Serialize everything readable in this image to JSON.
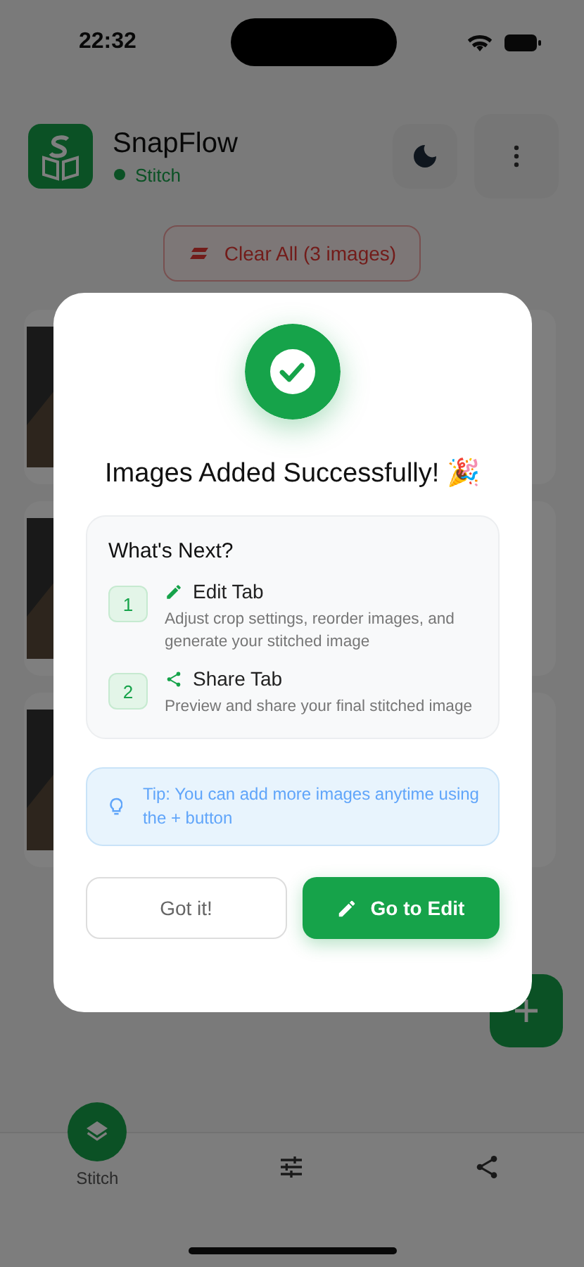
{
  "status_bar": {
    "time": "22:32"
  },
  "header": {
    "title": "SnapFlow",
    "subtitle": "Stitch"
  },
  "clear_button": {
    "label": "Clear All (3 images)"
  },
  "dialog": {
    "title": "Images Added Successfully! 🎉",
    "section_title": "What's Next?",
    "steps": [
      {
        "number": "1",
        "kind": "edit",
        "title": "Edit Tab",
        "description": "Adjust crop settings, reorder images, and generate your stitched image"
      },
      {
        "number": "2",
        "kind": "share",
        "title": "Share Tab",
        "description": "Preview and share your final stitched image"
      }
    ],
    "tip": "Tip: You can add more images anytime using the + button",
    "buttons": [
      {
        "label": "Got it!",
        "kind": "secondary"
      },
      {
        "label": "Go to Edit",
        "kind": "primary"
      }
    ]
  },
  "bottom_nav": {
    "items": [
      {
        "kind": "stitch",
        "label": "Stitch",
        "selected": true
      },
      {
        "kind": "edit",
        "selected": false
      },
      {
        "kind": "share",
        "selected": false
      }
    ]
  }
}
